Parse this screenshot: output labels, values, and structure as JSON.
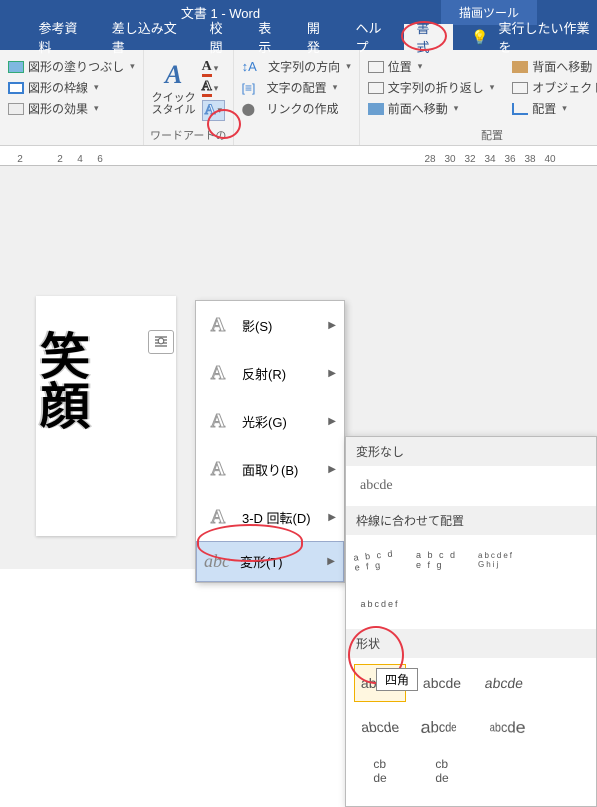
{
  "titlebar": {
    "title": "文書 1  -  Word",
    "tool": "描画ツール"
  },
  "tabs": {
    "items": [
      "参考資料",
      "差し込み文書",
      "校閲",
      "表示",
      "開発",
      "ヘルプ",
      "書式"
    ],
    "active_index": 6,
    "tell_me": "実行したい作業を"
  },
  "ribbon": {
    "shape_group": {
      "fill": "図形の塗りつぶし",
      "outline": "図形の枠線",
      "effects": "図形の効果"
    },
    "wordart_group": {
      "quick_style": "クイック\nスタイル",
      "label": "ワードアートの"
    },
    "text_group": {
      "direction": "文字列の方向",
      "align": "文字の配置",
      "link": "リンクの作成"
    },
    "arrange_group": {
      "position": "位置",
      "wrap": "文字列の折り返し",
      "bring_forward": "前面へ移動",
      "send_backward": "背面へ移動",
      "selection_pane": "オブジェクトの",
      "align_btn": "配置",
      "label": "配置"
    }
  },
  "ruler": {
    "left": [
      "2",
      "",
      "2",
      "4",
      "6"
    ],
    "right": [
      "28",
      "30",
      "32",
      "34",
      "36",
      "38",
      "40"
    ]
  },
  "wordart_text": {
    "c1": "笑",
    "c2": "顔"
  },
  "dropdown": {
    "items": [
      {
        "label": "影(S)"
      },
      {
        "label": "反射(R)"
      },
      {
        "label": "光彩(G)"
      },
      {
        "label": "面取り(B)"
      },
      {
        "label": "3-D 回転(D)"
      },
      {
        "label": "変形(T)",
        "abc": true
      }
    ],
    "hover_index": 5
  },
  "gallery": {
    "none_head": "変形なし",
    "none_sample": "abcde",
    "follow_head": "枠線に合わせて配置",
    "shape_head": "形状",
    "follow_items": [
      "a b c d e f g",
      "a b c d e f g",
      "abcdef Ghij",
      "abcdef"
    ],
    "shape_row1": [
      "abcde",
      "abcde",
      "abcde",
      "abcde"
    ],
    "shape_row2": [
      "abcde",
      "abcde"
    ],
    "tooltip": "四角"
  }
}
